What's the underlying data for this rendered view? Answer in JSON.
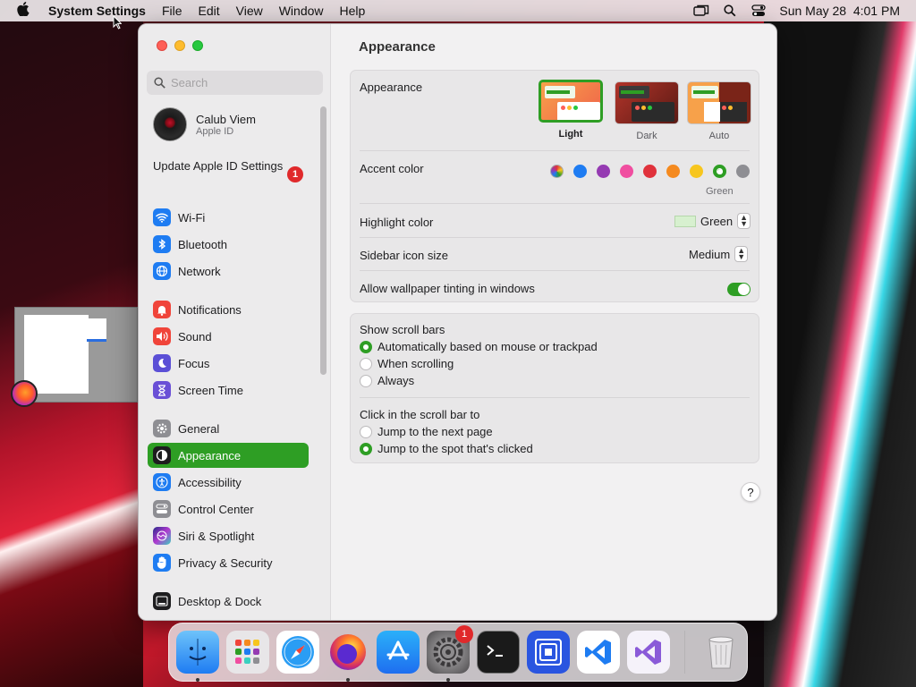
{
  "menubar": {
    "app": "System Settings",
    "menus": [
      "File",
      "Edit",
      "View",
      "Window",
      "Help"
    ],
    "clock": "Sun May 28  4:01 PM"
  },
  "sidebar": {
    "search_placeholder": "Search",
    "user": {
      "name": "Calub Viem",
      "sub": "Apple ID"
    },
    "update": {
      "label": "Update Apple ID Settings",
      "badge": "1"
    },
    "items": [
      {
        "label": "Wi-Fi",
        "icon": "wifi-icon",
        "color": "#1e7cf2"
      },
      {
        "label": "Bluetooth",
        "icon": "bluetooth-icon",
        "color": "#1e7cf2"
      },
      {
        "label": "Network",
        "icon": "globe-icon",
        "color": "#1e7cf2"
      },
      {
        "label": "Notifications",
        "icon": "bell-icon",
        "color": "#f0443a"
      },
      {
        "label": "Sound",
        "icon": "speaker-icon",
        "color": "#f0443a"
      },
      {
        "label": "Focus",
        "icon": "moon-icon",
        "color": "#5b4fd6"
      },
      {
        "label": "Screen Time",
        "icon": "hourglass-icon",
        "color": "#6a4fd6"
      },
      {
        "label": "General",
        "icon": "gear-icon",
        "color": "#8e8e93"
      },
      {
        "label": "Appearance",
        "icon": "appearance-icon",
        "color": "#1d1d1f"
      },
      {
        "label": "Accessibility",
        "icon": "accessibility-icon",
        "color": "#1e7cf2"
      },
      {
        "label": "Control Center",
        "icon": "toggles-icon",
        "color": "#8e8e93"
      },
      {
        "label": "Siri & Spotlight",
        "icon": "siri-icon",
        "color": "#b03ad0"
      },
      {
        "label": "Privacy & Security",
        "icon": "hand-icon",
        "color": "#1e7cf2"
      },
      {
        "label": "Desktop & Dock",
        "icon": "dock-icon",
        "color": "#1d1d1f"
      }
    ],
    "selected": "Appearance"
  },
  "content": {
    "title": "Appearance",
    "appearance": {
      "label": "Appearance",
      "options": [
        {
          "name": "Light",
          "selected": true
        },
        {
          "name": "Dark",
          "selected": false
        },
        {
          "name": "Auto",
          "selected": false
        }
      ]
    },
    "accent": {
      "label": "Accent color",
      "colors": [
        "multicolor",
        "#1e7cf2",
        "#953ab2",
        "#f04ea0",
        "#e0323c",
        "#f58a1f",
        "#f7c61e",
        "#2e9e24",
        "#8e8e93"
      ],
      "selected": "Green"
    },
    "highlight": {
      "label": "Highlight color",
      "value": "Green",
      "swatch": "#d7f0cf"
    },
    "sidebar_icon_size": {
      "label": "Sidebar icon size",
      "value": "Medium"
    },
    "wallpaper_tint": {
      "label": "Allow wallpaper tinting in windows",
      "on": true
    },
    "scroll_bars": {
      "label": "Show scroll bars",
      "options": [
        "Automatically based on mouse or trackpad",
        "When scrolling",
        "Always"
      ],
      "selected": 0
    },
    "click_scroll": {
      "label": "Click in the scroll bar to",
      "options": [
        "Jump to the next page",
        "Jump to the spot that's clicked"
      ],
      "selected": 1
    },
    "help": "?"
  },
  "dock": {
    "apps": [
      {
        "name": "Finder",
        "icon": "finder-icon",
        "running": true
      },
      {
        "name": "Launchpad",
        "icon": "launchpad-icon",
        "running": false
      },
      {
        "name": "Safari",
        "icon": "safari-icon",
        "running": false
      },
      {
        "name": "Firefox",
        "icon": "firefox-icon",
        "running": true
      },
      {
        "name": "App Store",
        "icon": "appstore-icon",
        "running": false
      },
      {
        "name": "System Settings",
        "icon": "settings-icon",
        "running": true,
        "badge": "1"
      },
      {
        "name": "Terminal",
        "icon": "terminal-icon",
        "running": false
      },
      {
        "name": "Simulator",
        "icon": "simulator-icon",
        "running": false
      },
      {
        "name": "VS Code",
        "icon": "vscode-icon",
        "running": false
      },
      {
        "name": "Visual Studio",
        "icon": "visualstudio-icon",
        "running": false
      }
    ],
    "trash": "trash-icon"
  }
}
